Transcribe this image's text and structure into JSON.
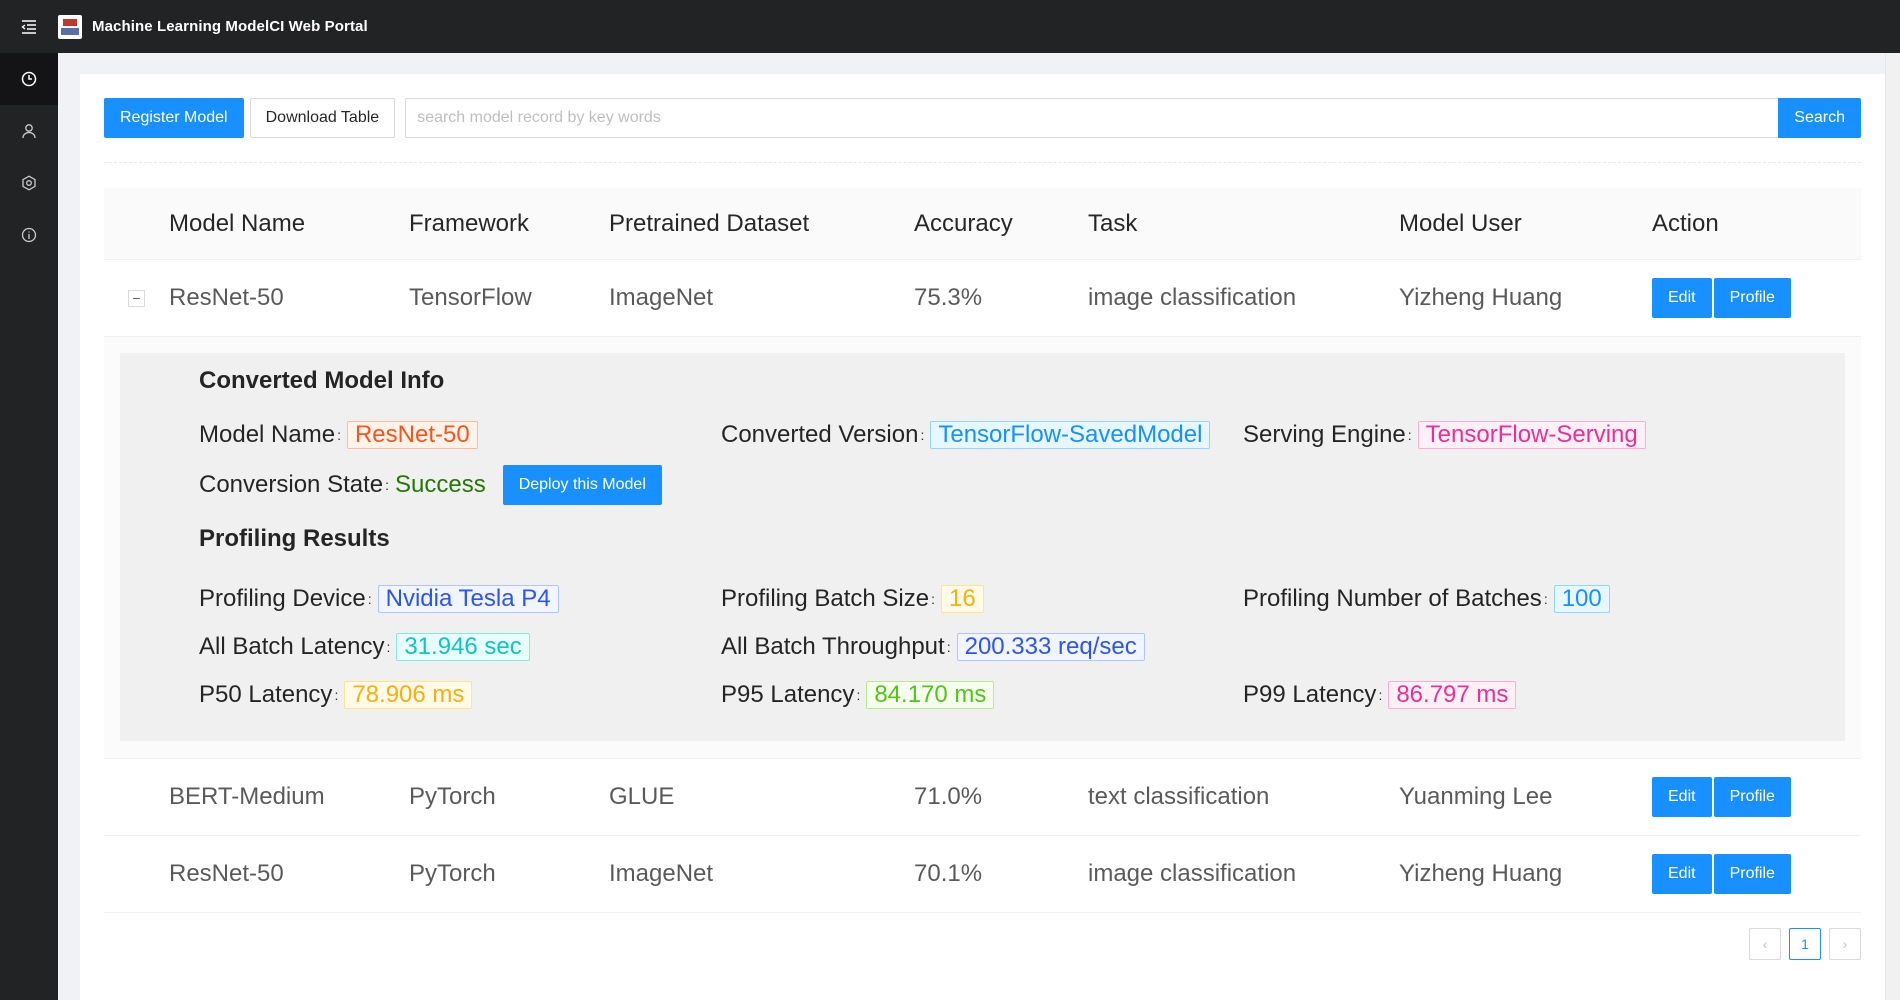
{
  "app": {
    "title": "Machine Learning ModelCI Web Portal"
  },
  "sidebar": {
    "items": [
      {
        "icon": "dashboard-icon"
      },
      {
        "icon": "user-icon"
      },
      {
        "icon": "settings-icon"
      },
      {
        "icon": "info-icon"
      }
    ]
  },
  "toolbar": {
    "register_label": "Register Model",
    "download_label": "Download Table",
    "search_placeholder": "search model record by key words",
    "search_value": "",
    "search_label": "Search"
  },
  "table": {
    "columns": [
      "Model Name",
      "Framework",
      "Pretrained Dataset",
      "Accuracy",
      "Task",
      "Model User",
      "Action"
    ],
    "rows": [
      {
        "name": "ResNet-50",
        "framework": "TensorFlow",
        "dataset": "ImageNet",
        "accuracy": "75.3%",
        "task": "image classification",
        "user": "Yizheng Huang",
        "edit": "Edit",
        "profile": "Profile",
        "expand": "−"
      },
      {
        "name": "BERT-Medium",
        "framework": "PyTorch",
        "dataset": "GLUE",
        "accuracy": "71.0%",
        "task": "text classification",
        "user": "Yuanming Lee",
        "edit": "Edit",
        "profile": "Profile"
      },
      {
        "name": "ResNet-50",
        "framework": "PyTorch",
        "dataset": "ImageNet",
        "accuracy": "70.1%",
        "task": "image classification",
        "user": "Yizheng Huang",
        "edit": "Edit",
        "profile": "Profile"
      }
    ]
  },
  "expanded": {
    "converted_title": "Converted Model Info",
    "model_name_label": "Model Name",
    "model_name_value": "ResNet-50",
    "converted_version_label": "Converted Version",
    "converted_version_value": "TensorFlow-SavedModel",
    "serving_engine_label": "Serving Engine",
    "serving_engine_value": "TensorFlow-Serving",
    "conversion_state_label": "Conversion State",
    "conversion_state_value": "Success",
    "deploy_label": "Deploy this Model",
    "profiling_title": "Profiling Results",
    "device_label": "Profiling Device",
    "device_value": "Nvidia Tesla P4",
    "batch_size_label": "Profiling Batch Size",
    "batch_size_value": "16",
    "num_batches_label": "Profiling Number of Batches",
    "num_batches_value": "100",
    "all_latency_label": "All Batch Latency",
    "all_latency_value": "31.946 sec",
    "throughput_label": "All Batch Throughput",
    "throughput_value": "200.333 req/sec",
    "p50_label": "P50 Latency",
    "p50_value": "78.906 ms",
    "p95_label": "P95 Latency",
    "p95_value": "84.170 ms",
    "p99_label": "P99 Latency",
    "p99_value": "86.797 ms",
    "colon": ":"
  },
  "pagination": {
    "prev": "‹",
    "current": "1",
    "next": "›"
  },
  "colors": {
    "primary": "#1890ff",
    "topbar": "#222325",
    "success": "#237804"
  }
}
